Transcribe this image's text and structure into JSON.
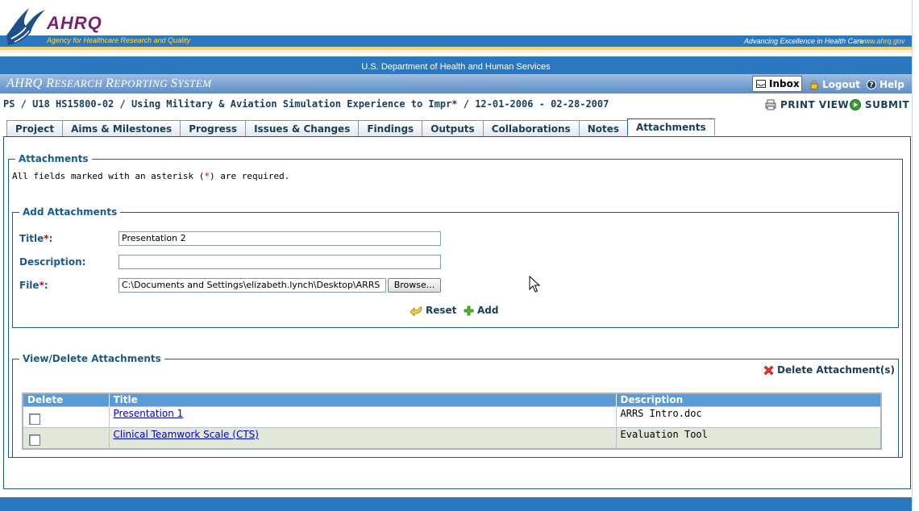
{
  "header": {
    "logo_text": "AHRQ",
    "agency_name": "Agency for Healthcare Research and Quality",
    "tagline": "Advancing Excellence in Health Care",
    "site_url": "www.ahrq.gov",
    "department": "U.S. Department of Health and Human Services",
    "system_title_parts": [
      "AHRQ ",
      "R",
      "ESEARCH ",
      "R",
      "EPORTING ",
      "S",
      "YSTEM"
    ]
  },
  "topnav": {
    "inbox": "Inbox",
    "logout": "Logout",
    "help": "Help"
  },
  "breadcrumb": "PS / U18 HS15800-02 / Using Military & Aviation Simulation Experience to Impr* / 12-01-2006 - 02-28-2007",
  "actions": {
    "print_view": "PRINT VIEW",
    "submit": "SUBMIT"
  },
  "tabs": [
    {
      "label": "Project",
      "active": false
    },
    {
      "label": "Aims & Milestones",
      "active": false
    },
    {
      "label": "Progress",
      "active": false
    },
    {
      "label": "Issues & Changes",
      "active": false
    },
    {
      "label": "Findings",
      "active": false
    },
    {
      "label": "Outputs",
      "active": false
    },
    {
      "label": "Collaborations",
      "active": false
    },
    {
      "label": "Notes",
      "active": false
    },
    {
      "label": "Attachments",
      "active": true
    }
  ],
  "attachments": {
    "legend": "Attachments",
    "required_note_pre": "All fields marked with an asterisk (",
    "required_note_star": "*",
    "required_note_post": ") are required."
  },
  "add_form": {
    "legend": "Add Attachments",
    "title_label": "Title",
    "description_label": "Description:",
    "file_label": "File",
    "asterisk": "*",
    "colon": ":",
    "title_value": "Presentation 2",
    "description_value": "",
    "file_value": "C:\\Documents and Settings\\elizabeth.lynch\\Desktop\\ARRS",
    "browse_label": "Browse...",
    "reset_label": "Reset",
    "add_label": "Add"
  },
  "view_delete": {
    "legend": "View/Delete Attachments",
    "delete_button": "Delete Attachment(s)",
    "columns": [
      "Delete",
      "Title",
      "Description"
    ],
    "rows": [
      {
        "title": "Presentation 1",
        "description": "ARRS Intro.doc",
        "checked": false
      },
      {
        "title": "Clinical Teamwork Scale (CTS)",
        "description": "Evaluation Tool",
        "checked": false
      }
    ]
  },
  "colors": {
    "header_blue": "#2c78c0",
    "system_band": "#5b8ec8",
    "label_blue": "#1a5a8a",
    "table_header": "#5a9ad6",
    "alt_row": "#e2e8d8",
    "required_red": "#cc0000"
  }
}
